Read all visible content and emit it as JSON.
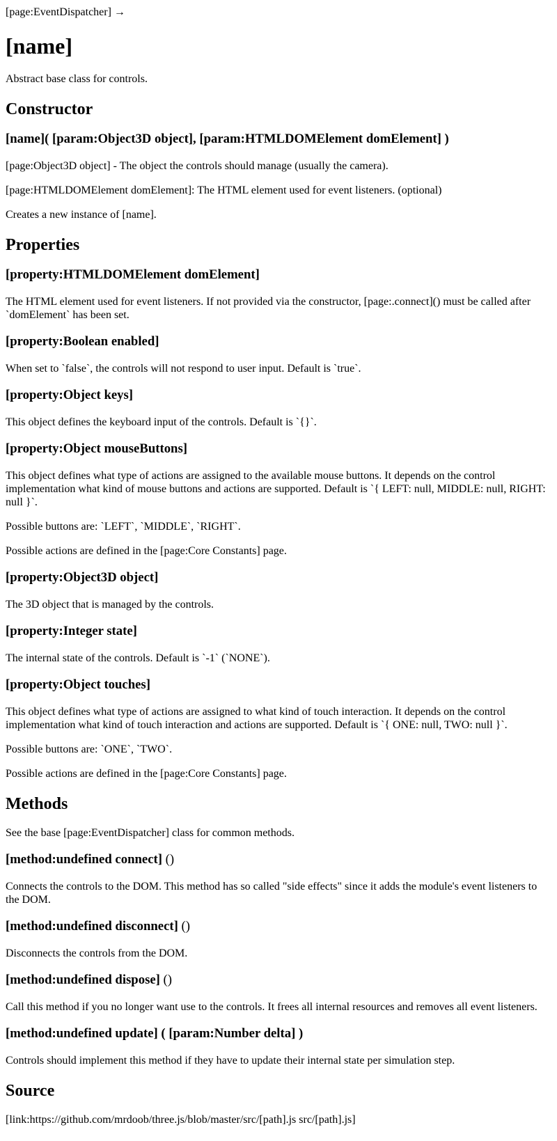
{
  "breadcrumb": "[page:EventDispatcher] →",
  "title": "[name]",
  "intro": "Abstract base class for controls.",
  "constructor": {
    "heading": "Constructor",
    "signature": "[name]( [param:Object3D object], [param:HTMLDOMElement domElement] )",
    "param_object": "[page:Object3D object] - The object the controls should manage (usually the camera).",
    "param_dom": "[page:HTMLDOMElement domElement]: The HTML element used for event listeners. (optional)",
    "desc": "Creates a new instance of [name]."
  },
  "properties": {
    "heading": "Properties",
    "items": [
      {
        "name": "[property:HTMLDOMElement domElement]",
        "paras": [
          "The HTML element used for event listeners. If not provided via the constructor, [page:.connect]() must be called after `domElement` has been set."
        ]
      },
      {
        "name": "[property:Boolean enabled]",
        "paras": [
          "When set to `false`, the controls will not respond to user input. Default is `true`."
        ]
      },
      {
        "name": "[property:Object keys]",
        "paras": [
          "This object defines the keyboard input of the controls. Default is `{}`."
        ]
      },
      {
        "name": "[property:Object mouseButtons]",
        "paras": [
          "This object defines what type of actions are assigned to the available mouse buttons. It depends on the control implementation what kind of mouse buttons and actions are supported. Default is `{ LEFT: null, MIDDLE: null, RIGHT: null }`.",
          "Possible buttons are: `LEFT`, `MIDDLE`, `RIGHT`.",
          "Possible actions are defined in the [page:Core Constants] page."
        ]
      },
      {
        "name": "[property:Object3D object]",
        "paras": [
          "The 3D object that is managed by the controls."
        ]
      },
      {
        "name": "[property:Integer state]",
        "paras": [
          "The internal state of the controls. Default is `-1` (`NONE`)."
        ]
      },
      {
        "name": "[property:Object touches]",
        "paras": [
          "This object defines what type of actions are assigned to what kind of touch interaction. It depends on the control implementation what kind of touch interaction and actions are supported. Default is `{ ONE: null, TWO: null }`.",
          "Possible buttons are: `ONE`, `TWO`.",
          "Possible actions are defined in the [page:Core Constants] page."
        ]
      }
    ]
  },
  "methods": {
    "heading": "Methods",
    "intro": "See the base [page:EventDispatcher] class for common methods.",
    "items": [
      {
        "name": "[method:undefined connect]",
        "params": " ()",
        "desc": "Connects the controls to the DOM. This method has so called \"side effects\" since it adds the module's event listeners to the DOM."
      },
      {
        "name": "[method:undefined disconnect]",
        "params": " ()",
        "desc": "Disconnects the controls from the DOM."
      },
      {
        "name": "[method:undefined dispose]",
        "params": " ()",
        "desc": "Call this method if you no longer want use to the controls. It frees all internal resources and removes all event listeners."
      },
      {
        "name": "[method:undefined update]",
        "params": " ( [param:Number delta] )",
        "desc": "Controls should implement this method if they have to update their internal state per simulation step."
      }
    ]
  },
  "source": {
    "heading": "Source",
    "link": "[link:https://github.com/mrdoob/three.js/blob/master/src/[path].js src/[path].js]"
  }
}
